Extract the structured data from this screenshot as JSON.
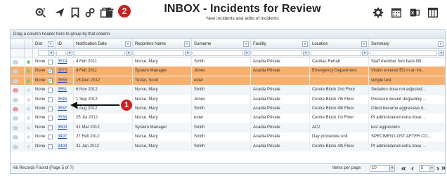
{
  "title": "INBOX - Incidents for Review",
  "subtitle": "New incidents and edits of incidents",
  "toolbar_left_icons": [
    "refresh-settings-icon",
    "send-icon",
    "bookmark-icon",
    "link-icon",
    "copy-icon",
    "trash-icon"
  ],
  "toolbar_badge": "2",
  "toolbar_right_icons": [
    "gear-icon",
    "calendar-icon",
    "export-icon",
    "columns-icon"
  ],
  "group_bar_text": "Drag a column header here to group by that column",
  "columns": {
    "dist": "Dist",
    "id": "ID",
    "notification_date": "Notification Date",
    "reporter_name": "Reporters Name",
    "surname": "Surname",
    "facility": "Facility",
    "location": "Location",
    "summary": "Summary"
  },
  "rows": [
    {
      "pill": "grey",
      "dot": "green",
      "dist": "None",
      "checked": false,
      "id": "3574",
      "date": "4 Feb 2011",
      "reporter": "Nurse, Mary",
      "surname": "Smith",
      "facility": "Acadia Private",
      "location": "Cardiac Rehab",
      "summary": "Staff member hurt back lifti...",
      "highlight": false
    },
    {
      "pill": "grey",
      "dot": "green",
      "dist": "None",
      "checked": true,
      "id": "3573",
      "date": "4 Feb 2011",
      "reporter": "System Manager",
      "surname": "Jones",
      "facility": "Acadia Private",
      "location": "Emergency Department",
      "summary": "Visitor entered ED in an int...",
      "highlight": true
    },
    {
      "pill": "grey",
      "dot": "green",
      "dist": "None",
      "checked": true,
      "id": "3566",
      "date": "15 Dec 2012",
      "reporter": "Tester, Scott",
      "surname": "ester",
      "facility": "",
      "location": "",
      "summary": "simple test",
      "highlight": true
    },
    {
      "pill": "red",
      "dot": "grey",
      "dist": "None",
      "checked": false,
      "id": "3551",
      "date": "6 Nov 2012",
      "reporter": "Nurse, Mary",
      "surname": "Smith",
      "facility": "Acadia Private",
      "location": "Centre Block 2nd Floor",
      "summary": "Sedation dose not adjusted...",
      "highlight": false
    },
    {
      "pill": "grey",
      "dot": "grey",
      "dist": "None",
      "checked": false,
      "id": "3545",
      "date": "1 Sep 2012",
      "reporter": "Nurse, Mary",
      "surname": "Jones",
      "facility": "Acadia Private",
      "location": "Centre Block 7th Floor",
      "summary": "Pressure wound degrading ...",
      "highlight": false
    },
    {
      "pill": "red",
      "dot": "grey",
      "dist": "None",
      "checked": false,
      "id": "3537",
      "date": "5 Aug 2012",
      "reporter": "Nurse, Mary",
      "surname": "Smith",
      "facility": "Acadia Private",
      "location": "Centre Block 4th Floor",
      "summary": "Client became aggressive d...",
      "highlight": false
    },
    {
      "pill": "grey",
      "dot": "grey",
      "dist": "None",
      "checked": false,
      "id": "3536",
      "date": "25 Jul 2012",
      "reporter": "Nurse, Mary",
      "surname": "ester",
      "facility": "Acadia Private",
      "location": "Centre Block 1st Floor",
      "summary": "Pt administered extra dose ...",
      "highlight": false
    },
    {
      "pill": "grey",
      "dot": "grey",
      "dist": "None",
      "checked": false,
      "id": "3503",
      "date": "31 Mar 2012",
      "reporter": "System Manager",
      "surname": "Smith",
      "facility": "Acadia Private",
      "location": "AC2",
      "summary": "test aggression",
      "highlight": false
    },
    {
      "pill": "grey",
      "dot": "grey",
      "dist": "None",
      "checked": false,
      "id": "3497",
      "date": "27 Feb 2012",
      "reporter": "Nurse, Mary",
      "surname": "Smith",
      "facility": "Acadia Private",
      "location": "Day procedure unit",
      "summary": "SPECIMEN LOST AFTER CO...",
      "highlight": false
    },
    {
      "pill": "grey",
      "dot": "grey",
      "dist": "None",
      "checked": false,
      "id": "3493",
      "date": "31 Jan 2012",
      "reporter": "Nurse, Mary",
      "surname": "Smith",
      "facility": "Acadia Private",
      "location": "Centre Block 4th Floor",
      "summary": "Pt administered extra dose ...",
      "highlight": false
    }
  ],
  "footer": {
    "records_found": "66 Records Found (Page 5 of 7)",
    "items_per_page_label": "Items per page:",
    "items_per_page_value": "10",
    "current_page": "5"
  },
  "annotation_badge": "1",
  "colors": {
    "highlight_row": "#f8b06e",
    "badge": "#cc1f1f",
    "link": "#1a4fb8"
  }
}
